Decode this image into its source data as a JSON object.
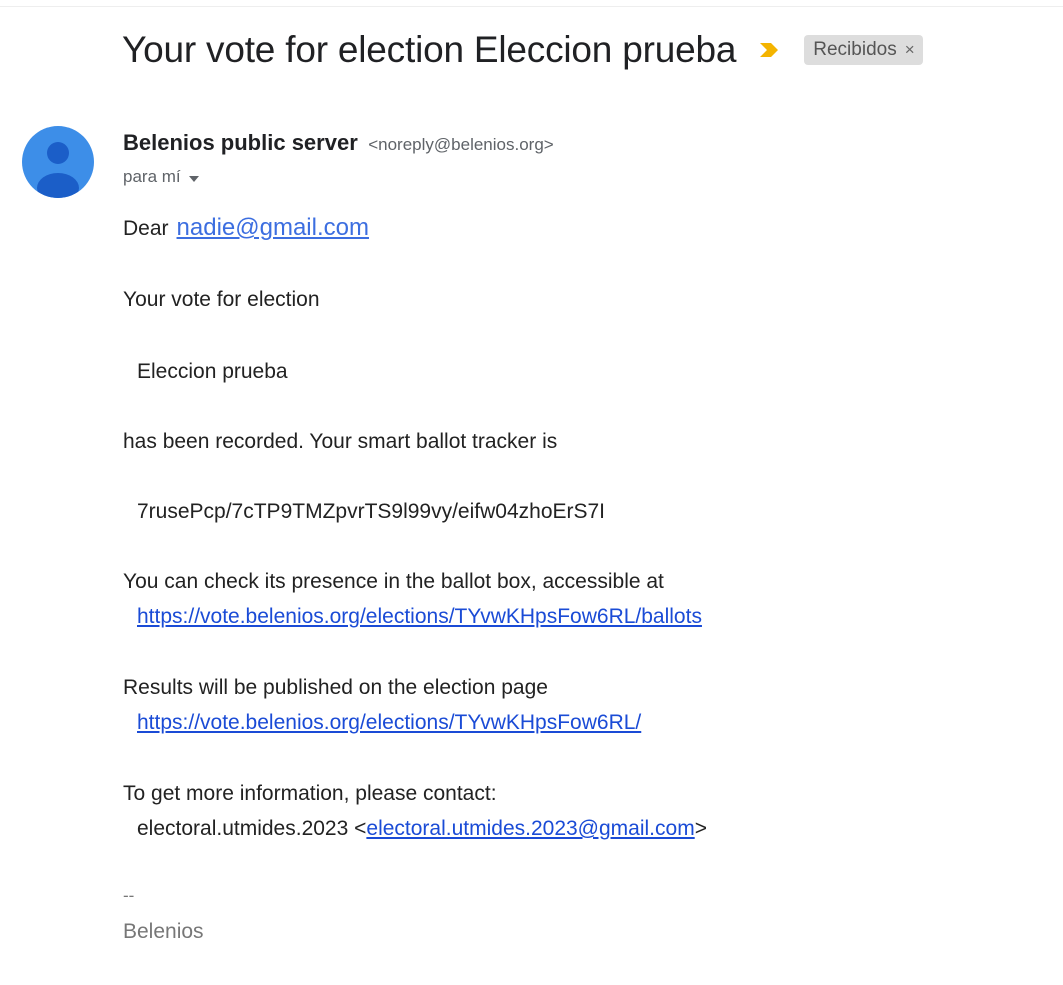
{
  "email": {
    "subject": "Your vote for election Eleccion prueba",
    "label": "Recibidos",
    "label_close": "×",
    "sender_name": "Belenios public server",
    "sender_email": "<noreply@belenios.org>",
    "recipient": "para mí",
    "body": {
      "greeting_prefix": "Dear",
      "greeting_email": "nadie@gmail.com",
      "line_vote_for": "Your vote for election",
      "election_name": "Eleccion prueba",
      "line_recorded": "has been recorded. Your smart ballot tracker is",
      "tracker": "7rusePcp/7cTP9TMZpvrTS9l99vy/eifw04zhoErS7I",
      "line_check": "You can check its presence in the ballot box, accessible at",
      "ballots_url": "https://vote.belenios.org/elections/TYvwKHpsFow6RL/ballots",
      "line_results": "Results will be published on the election page",
      "election_url": "https://vote.belenios.org/elections/TYvwKHpsFow6RL/",
      "line_contact": "To get more information, please contact:",
      "contact_name": "electoral.utmides.2023 <",
      "contact_email": "electoral.utmides.2023@gmail.com",
      "contact_close": ">",
      "sig_dash": "--",
      "sig_name": "Belenios"
    }
  },
  "colors": {
    "avatar": "#3d8ee8",
    "importance": "#f4b400",
    "link": "#1a4bd6"
  },
  "icons": {
    "importance": "importance-marker-icon",
    "avatar": "person-avatar-icon",
    "caret": "caret-down-icon"
  }
}
